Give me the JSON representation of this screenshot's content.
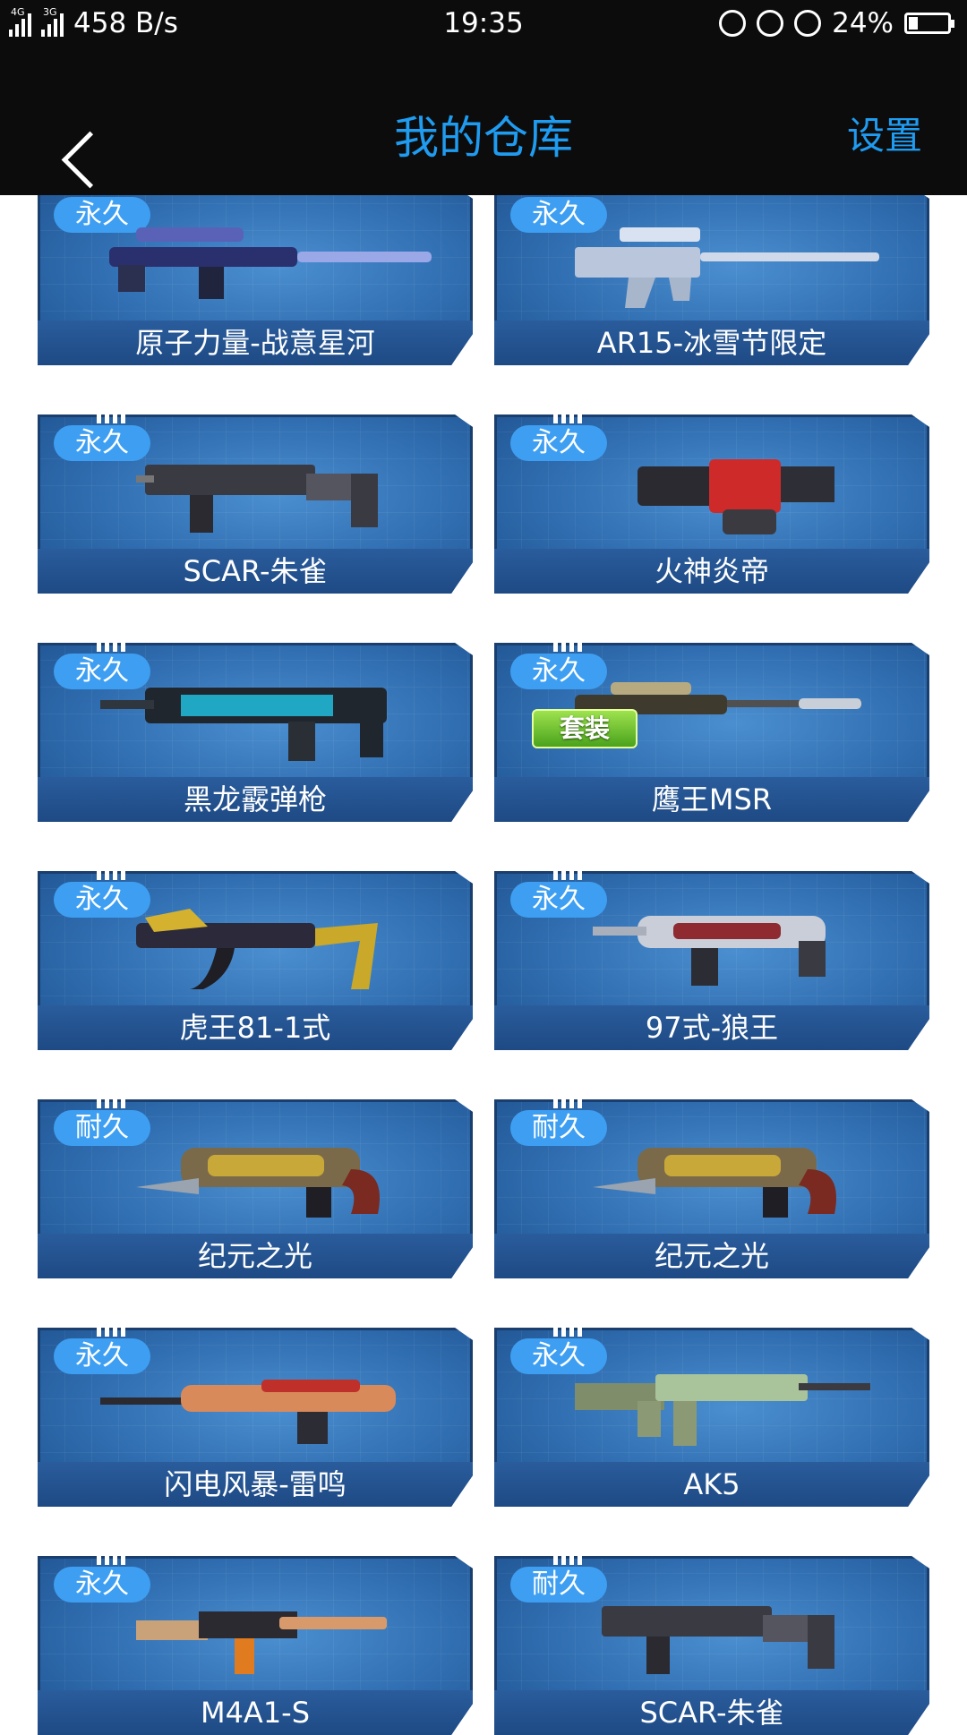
{
  "status_bar": {
    "network_1": "4G",
    "network_2": "3G",
    "speed": "458 B/s",
    "time": "19:35",
    "battery": "24%",
    "battery_level": 0.24
  },
  "header": {
    "title": "我的仓库",
    "settings_label": "设置"
  },
  "colors": {
    "accent": "#1f9bf0",
    "badge": "#3e9ff2",
    "card": "#2f6db0"
  },
  "items": [
    {
      "badge": "永久",
      "name": "原子力量-战意星河"
    },
    {
      "badge": "永久",
      "name": "AR15-冰雪节限定"
    },
    {
      "badge": "永久",
      "name": "SCAR-朱雀"
    },
    {
      "badge": "永久",
      "name": "火神炎帝"
    },
    {
      "badge": "永久",
      "name": "黑龙霰弹枪"
    },
    {
      "badge": "永久",
      "name": "鹰王MSR",
      "tag": "套装"
    },
    {
      "badge": "永久",
      "name": "虎王81-1式"
    },
    {
      "badge": "永久",
      "name": "97式-狼王"
    },
    {
      "badge": "耐久",
      "name": "纪元之光"
    },
    {
      "badge": "耐久",
      "name": "纪元之光"
    },
    {
      "badge": "永久",
      "name": "闪电风暴-雷鸣"
    },
    {
      "badge": "永久",
      "name": "AK5"
    },
    {
      "badge": "永久",
      "name": "M4A1-S"
    },
    {
      "badge": "耐久",
      "name": "SCAR-朱雀"
    }
  ]
}
